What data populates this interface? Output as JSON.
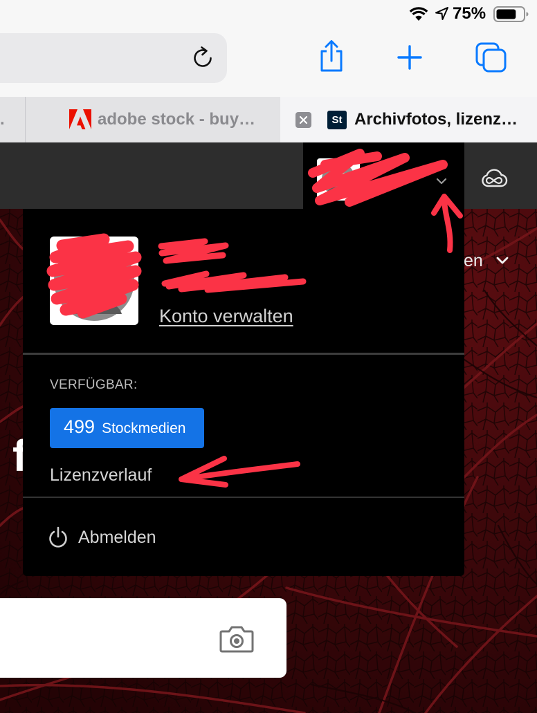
{
  "status_bar": {
    "battery_percent": "75%",
    "battery_level": 0.75
  },
  "browser": {
    "tabs": [
      {
        "label": ".",
        "active": false
      },
      {
        "label": "adobe stock - buy…",
        "favicon": "adobe-logo-icon",
        "active": false
      },
      {
        "label": "Archivfotos, lizenz…",
        "favicon_text": "St",
        "active": true
      }
    ]
  },
  "page": {
    "nav_fragment": "en",
    "hero_fragment": "f",
    "account_menu": {
      "manage_account": "Konto verwalten",
      "available_label": "VERFÜGBAR:",
      "credits_count": "499",
      "credits_unit": "Stockmedien",
      "license_history": "Lizenzverlauf",
      "sign_out": "Abmelden"
    }
  },
  "icons": [
    "wifi-icon",
    "location-arrow-icon",
    "battery-icon",
    "reload-icon",
    "share-icon",
    "plus-icon",
    "tabs-overview-icon",
    "close-icon",
    "adobe-logo-icon",
    "creative-cloud-icon",
    "chevron-down-icon",
    "power-icon",
    "camera-icon"
  ],
  "colors": {
    "safari_blue": "#0a7aff",
    "accent_blue": "#1473e6",
    "header_bg": "#2d2d2d",
    "menu_bg": "#000000",
    "annotation_red": "#fb3346",
    "leaf_red": "#4a0a0d"
  }
}
